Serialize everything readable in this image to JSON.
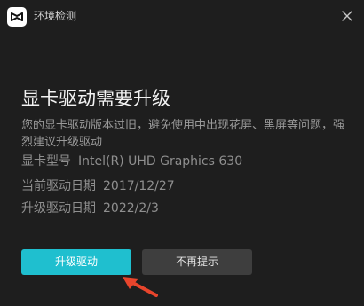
{
  "titlebar": {
    "title": "环境检测",
    "logo_icon": "capcut-logo-icon",
    "close_icon": "close-icon"
  },
  "content": {
    "headline": "显卡驱动需要升级",
    "description": "您的显卡驱动版本过旧，避免使用中出现花屏、黑屏等问题，强烈建议升级驱动",
    "gpu_model_label": "显卡型号",
    "gpu_model_value": "Intel(R) UHD Graphics 630",
    "current_date_label": "当前驱动日期",
    "current_date_value": "2017/12/27",
    "upgrade_date_label": "升级驱动日期",
    "upgrade_date_value": "2022/2/3"
  },
  "actions": {
    "upgrade_label": "升级驱动",
    "dismiss_label": "不再提示"
  },
  "colors": {
    "background": "#1e1e1e",
    "primary": "#1fbfcf",
    "secondary": "#3e3e3e",
    "annotation_arrow": "#e8452c"
  }
}
